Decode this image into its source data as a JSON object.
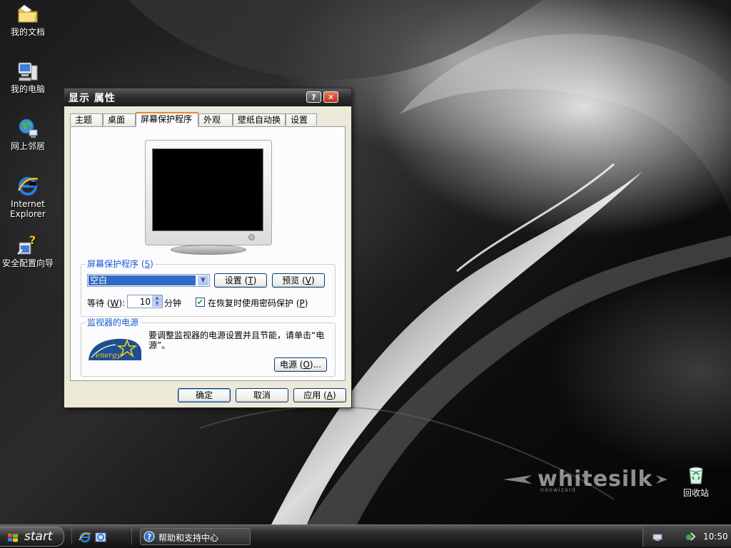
{
  "desktop": {
    "icons": [
      {
        "label": "我的文档"
      },
      {
        "label": "我的电脑"
      },
      {
        "label": "网上邻居"
      },
      {
        "label": "Internet Explorer"
      },
      {
        "label": "安全配置向导"
      },
      {
        "label": "回收站"
      }
    ],
    "brand": {
      "word": "whitesilk",
      "sub": "neowizard"
    }
  },
  "dialog": {
    "title": "显示 属性",
    "help_button": "?",
    "close_button": "✕",
    "tabs": [
      {
        "label": "主题"
      },
      {
        "label": "桌面"
      },
      {
        "label": "屏幕保护程序"
      },
      {
        "label": "外观"
      },
      {
        "label": "壁纸自动换"
      },
      {
        "label": "设置"
      }
    ],
    "active_tab": "屏幕保护程序",
    "screensaver": {
      "group_label": "屏幕保护程序",
      "group_key": "S",
      "selected": "空白",
      "settings_label": "设置",
      "settings_key": "T",
      "preview_label": "预览",
      "preview_key": "V",
      "wait_label": "等待",
      "wait_key": "W",
      "wait_value": "10",
      "wait_unit": "分钟",
      "password_label": "在恢复时使用密码保护",
      "password_key": "P",
      "password_checked": true
    },
    "power": {
      "group_label": "监视器的电源",
      "description": "要调整监视器的电源设置并且节能，请单击“电源”。",
      "logo_text": "energy",
      "button_label": "电源",
      "button_key": "O"
    },
    "buttons": {
      "ok": "确定",
      "cancel": "取消",
      "apply": "应用",
      "apply_key": "A"
    }
  },
  "taskbar": {
    "start_label": "start",
    "tasks": [
      {
        "label": "帮助和支持中心"
      }
    ],
    "clock": "10:50"
  },
  "colors": {
    "accent_blue": "#316ac5",
    "group_label": "#1d5bd0",
    "tab_highlight": "#e68b2c"
  }
}
